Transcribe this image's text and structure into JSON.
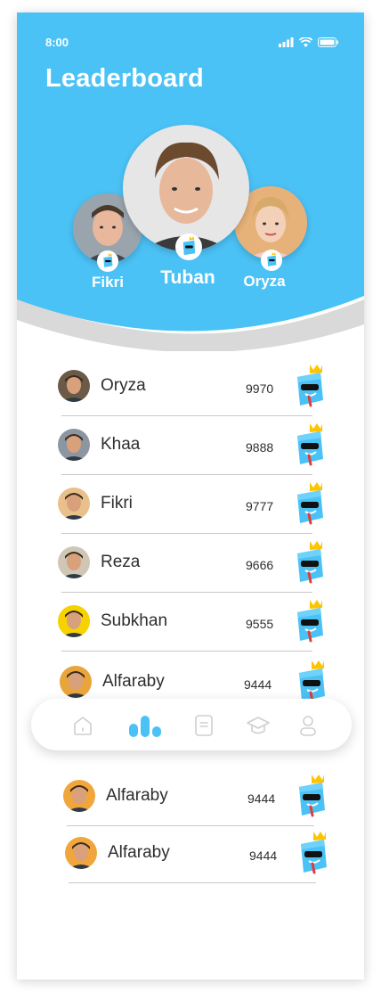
{
  "status_bar": {
    "time": "8:00",
    "icons": [
      "signal-icon",
      "wifi-icon",
      "battery-icon"
    ]
  },
  "header": {
    "title": "Leaderboard",
    "accent_color": "#4bc2f6"
  },
  "podium": [
    {
      "rank": 2,
      "name": "Fikri"
    },
    {
      "rank": 1,
      "name": "Tuban"
    },
    {
      "rank": 3,
      "name": "Oryza"
    }
  ],
  "leaderboard": [
    {
      "name": "Oryza",
      "score": "9970"
    },
    {
      "name": "Khaa",
      "score": "9888"
    },
    {
      "name": "Fikri",
      "score": "9777"
    },
    {
      "name": "Reza",
      "score": "9666"
    },
    {
      "name": "Subkhan",
      "score": "9555"
    },
    {
      "name": "Alfaraby",
      "score": "9444"
    },
    {
      "name": "Alfaraby",
      "score": "9444"
    },
    {
      "name": "Alfaraby",
      "score": "9444"
    }
  ],
  "bottom_nav": {
    "items": [
      "home-icon",
      "leaderboard-icon",
      "book-icon",
      "graduation-cap-icon",
      "profile-icon"
    ],
    "active": "leaderboard-icon"
  }
}
